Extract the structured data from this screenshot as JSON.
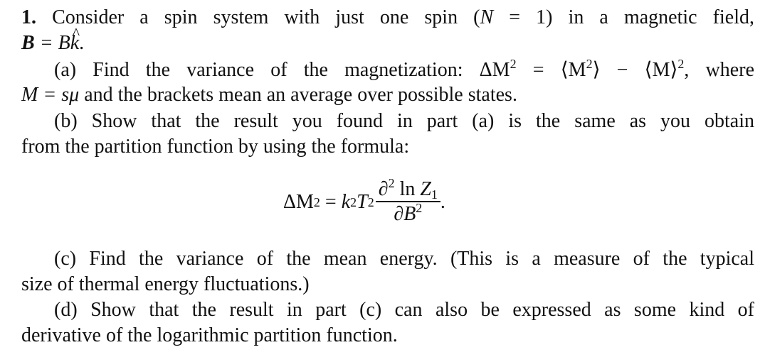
{
  "problem": {
    "number": "1.",
    "intro_line1": "Consider a spin system with just one spin (",
    "intro_N": "N",
    "intro_eq": " = 1) in a magnetic field,",
    "intro_B_bold": "B",
    "intro_line2_rest": " = B",
    "intro_k": "k",
    "intro_period": ".",
    "part_a": {
      "label": "(a)",
      "text1": "Find the variance of the magnetization: ΔM",
      "text1_exp": "2",
      "text1_mid": " = ⟨M",
      "text1_mid_exp": "2",
      "text1_mid2": "⟩ − ⟨M⟩",
      "text1_mid2_exp": "2",
      "text1_end": ", where",
      "text2_M": "M",
      "text2_eq": " = sμ",
      "text2_rest": " and the brackets mean an average over possible states."
    },
    "part_b": {
      "label": "(b)",
      "text1": "Show that the result you found in part (a) is the same as you obtain",
      "text2": "from the partition function by using the formula:"
    },
    "formula": {
      "lhs": "ΔM",
      "lhs_exp": "2",
      "equals": " = ",
      "k": "k",
      "k_exp": "2",
      "T": "T",
      "T_exp": "2",
      "numerator_partial": "∂",
      "numerator_exp": "2",
      "numerator_ln": " ln ",
      "numerator_Z": "Z",
      "numerator_sub": "1",
      "denominator_partial": "∂",
      "denominator_B": "B",
      "denominator_exp": "2",
      "period": "."
    },
    "part_c": {
      "label": "(c)",
      "text1": "Find the variance of the mean energy. (This is a measure of the typical",
      "text2": "size of thermal energy fluctuations.)"
    },
    "part_d": {
      "label": "(d)",
      "text1": "Show that the result in part (c) can also be expressed as some kind of",
      "text2": "derivative of the logarithmic partition function."
    }
  }
}
